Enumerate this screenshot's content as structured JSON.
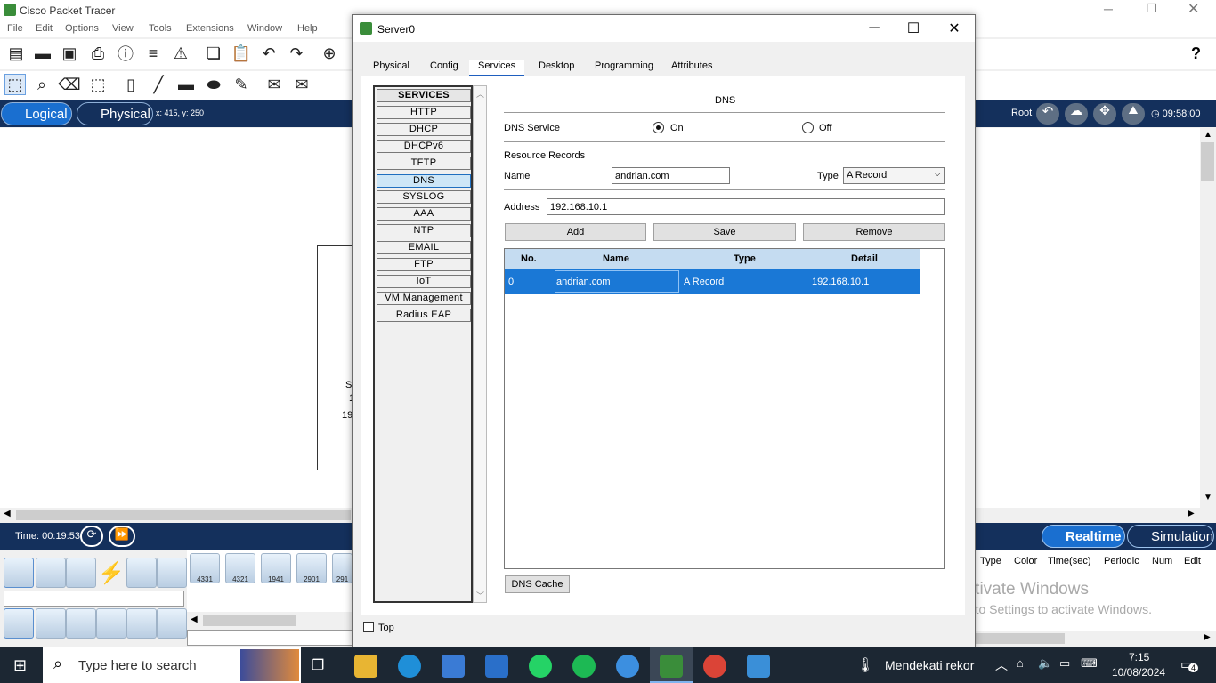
{
  "app": {
    "title": "Cisco Packet Tracer",
    "menu": [
      "File",
      "Edit",
      "Options",
      "View",
      "Tools",
      "Extensions",
      "Window",
      "Help"
    ],
    "help_label": "?",
    "mode_logical": "Logical",
    "mode_physical": "Physical",
    "coords": "x: 415, y: 250",
    "root_label": "Root",
    "clock": "09:58:00",
    "time_label": "Time: 00:19:53",
    "realtime_label": "Realtime",
    "simulation_label": "Simulation",
    "routers": [
      "4331",
      "4321",
      "1941",
      "2901",
      "291"
    ],
    "pdu_columns": [
      "Type",
      "Color",
      "Time(sec)",
      "Periodic",
      "Num",
      "Edit"
    ],
    "partial_text": [
      "S",
      "1",
      "19"
    ]
  },
  "dialog": {
    "title": "Server0",
    "tabs": [
      "Physical",
      "Config",
      "Services",
      "Desktop",
      "Programming",
      "Attributes"
    ],
    "active_tab": "Services",
    "services": [
      "SERVICES",
      "HTTP",
      "DHCP",
      "DHCPv6",
      "TFTP",
      "DNS",
      "SYSLOG",
      "AAA",
      "NTP",
      "EMAIL",
      "FTP",
      "IoT",
      "VM Management",
      "Radius EAP"
    ],
    "selected_service": "DNS",
    "dns": {
      "header": "DNS",
      "service_label": "DNS Service",
      "on_label": "On",
      "off_label": "Off",
      "state": "On",
      "resource_records_label": "Resource Records",
      "name_label": "Name",
      "name_value": "andrian.com",
      "type_label": "Type",
      "type_value": "A Record",
      "address_label": "Address",
      "address_value": "192.168.10.1",
      "add_label": "Add",
      "save_label": "Save",
      "remove_label": "Remove",
      "columns": [
        "No.",
        "Name",
        "Type",
        "Detail"
      ],
      "rows": [
        {
          "no": "0",
          "name": "andrian.com",
          "type": "A Record",
          "detail": "192.168.10.1"
        }
      ],
      "cache_label": "DNS Cache"
    },
    "top_label": "Top"
  },
  "watermark": {
    "line1": "Activate Windows",
    "line2": "Go to Settings to activate Windows."
  },
  "taskbar": {
    "search_placeholder": "Type here to search",
    "weather": "Mendekati rekor",
    "time": "7:15",
    "date": "10/08/2024",
    "notifications": "4"
  },
  "colors": {
    "accent": "#1a78d6",
    "mode_bar": "#14305c",
    "taskbar": "#1c2733"
  }
}
